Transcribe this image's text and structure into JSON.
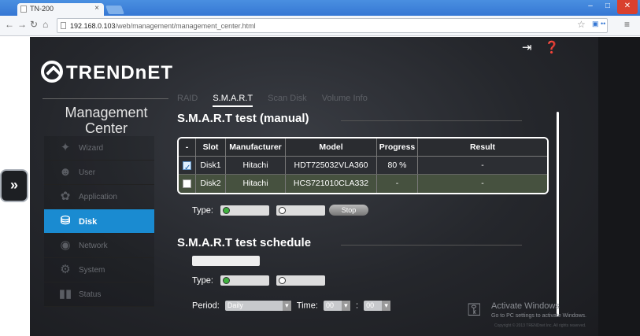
{
  "browser": {
    "tab_title": "TN-200",
    "tab_close": "×",
    "url_host": "192.168.0.103",
    "url_path": "/web/management/management_center.html",
    "win_min": "–",
    "win_max": "□",
    "win_close": "✕"
  },
  "side_toggle": "»",
  "logo_text": "TRENDnET",
  "management_center": "Management Center",
  "sidemenu": {
    "items": [
      {
        "label": "Wizard",
        "icon": "wizard-icon"
      },
      {
        "label": "User",
        "icon": "user-icon"
      },
      {
        "label": "Application",
        "icon": "application-icon"
      },
      {
        "label": "Disk",
        "icon": "disk-icon"
      },
      {
        "label": "Network",
        "icon": "network-icon"
      },
      {
        "label": "System",
        "icon": "system-icon"
      },
      {
        "label": "Status",
        "icon": "status-icon"
      }
    ]
  },
  "tabs": [
    "RAID",
    "S.M.A.R.T",
    "Scan Disk",
    "Volume Info"
  ],
  "smart_manual": {
    "title": "S.M.A.R.T test (manual)",
    "headers": [
      "-",
      "Slot",
      "Manufacturer",
      "Model",
      "Progress",
      "Result"
    ],
    "rows": [
      {
        "checked": true,
        "slot": "Disk1",
        "manufacturer": "Hitachi",
        "model": "HDT725032VLA360",
        "progress": "80 %",
        "result": "-"
      },
      {
        "checked": false,
        "slot": "Disk2",
        "manufacturer": "Hitachi",
        "model": "HCS721010CLA332",
        "progress": "-",
        "result": "-"
      }
    ],
    "type_label": "Type:",
    "stop_label": "Stop"
  },
  "smart_schedule": {
    "title": "S.M.A.R.T test schedule",
    "type_label": "Type:",
    "period_label": "Period:",
    "period_value": "Daily",
    "time_label": "Time:",
    "hour_value": "00",
    "minute_value": "00",
    "time_sep": ":"
  },
  "watermark": {
    "line1": "Activate Windows",
    "line2": "Go to PC settings to activate Windows."
  },
  "copyright": "Copyright © 2013 TRENDnet Inc. All rights reserved."
}
